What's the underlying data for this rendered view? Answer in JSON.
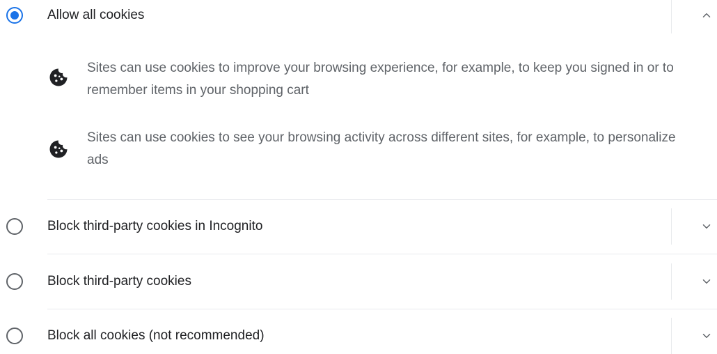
{
  "options": [
    {
      "label": "Allow all cookies",
      "selected": true,
      "expanded": true,
      "chevron_icon": "chevron-up-icon"
    },
    {
      "label": "Block third-party cookies in Incognito",
      "selected": false,
      "expanded": false,
      "chevron_icon": "chevron-down-icon"
    },
    {
      "label": "Block third-party cookies",
      "selected": false,
      "expanded": false,
      "chevron_icon": "chevron-down-icon"
    },
    {
      "label": "Block all cookies (not recommended)",
      "selected": false,
      "expanded": false,
      "chevron_icon": "chevron-down-icon"
    }
  ],
  "allow_all_details": [
    {
      "icon": "cookie-icon",
      "text": "Sites can use cookies to improve your browsing experience, for example, to keep you signed in or to remember items in your shopping cart"
    },
    {
      "icon": "cookie-icon",
      "text": "Sites can use cookies to see your browsing activity across different sites, for example, to personalize ads"
    }
  ],
  "colors": {
    "accent": "#1a73e8",
    "text_primary": "#202124",
    "text_secondary": "#5f6368",
    "divider": "#e8eaed"
  }
}
